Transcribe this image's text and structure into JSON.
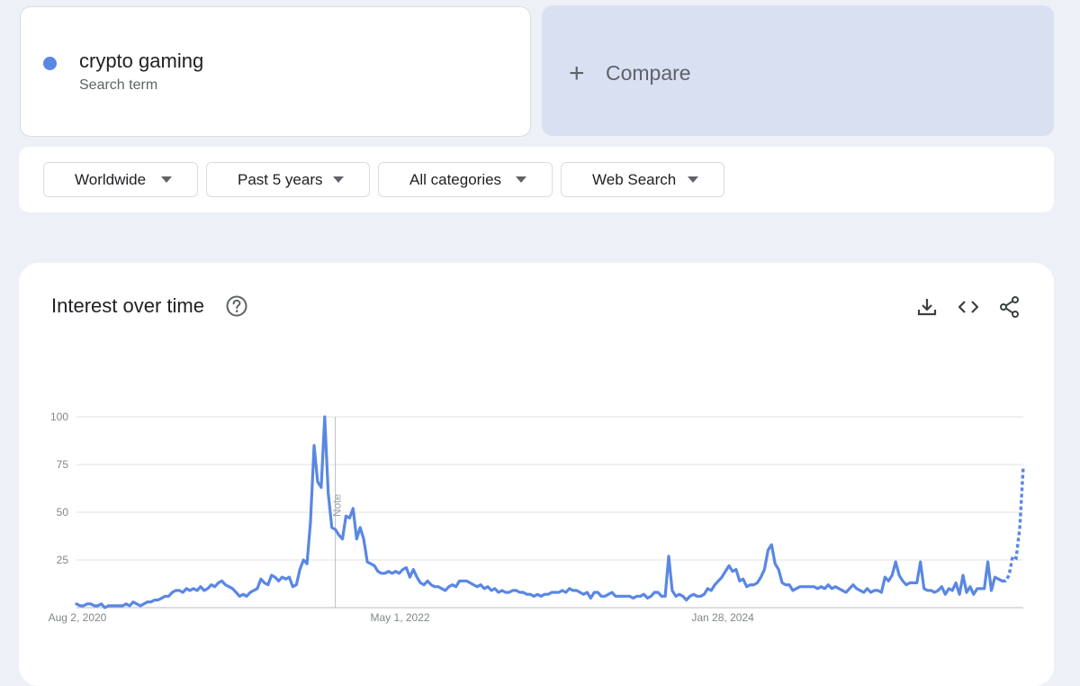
{
  "search_term": {
    "name": "crypto gaming",
    "subtitle": "Search term",
    "color": "#5a87e3"
  },
  "compare": {
    "label": "Compare",
    "background": "#d9e0f2"
  },
  "filters": [
    {
      "label": "Worldwide"
    },
    {
      "label": "Past 5 years"
    },
    {
      "label": "All categories"
    },
    {
      "label": "Web Search"
    }
  ],
  "chart_panel": {
    "title": "Interest over time",
    "icons": [
      "help-icon",
      "download-icon",
      "embed-icon",
      "share-icon"
    ]
  },
  "chart_data": {
    "type": "line",
    "yticks": [
      "100",
      "75",
      "50",
      "25"
    ],
    "ylim": [
      0,
      100
    ],
    "xtick_labels": [
      "Aug 2, 2020",
      "May 1, 2022",
      "Jan 28, 2024"
    ],
    "xtick_index": [
      0,
      91,
      182
    ],
    "note_label": "Note",
    "note_index": 73,
    "grid": true,
    "series_color": "#5a87e3",
    "partial_from_index": 261,
    "series": [
      {
        "values": [
          2,
          1,
          1,
          2,
          2,
          1,
          1,
          2,
          0,
          1,
          1,
          1,
          1,
          1,
          2,
          1,
          3,
          2,
          1,
          2,
          3,
          3,
          4,
          4,
          5,
          6,
          6,
          8,
          9,
          9,
          8,
          10,
          9,
          10,
          9,
          11,
          9,
          10,
          12,
          11,
          13,
          14,
          12,
          11,
          10,
          8,
          6,
          7,
          6,
          8,
          9,
          10,
          15,
          13,
          12,
          17,
          16,
          14,
          16,
          15,
          16,
          11,
          12,
          20,
          25,
          23,
          45,
          85,
          66,
          63,
          100,
          60,
          42,
          41,
          38,
          36,
          48,
          47,
          52,
          36,
          42,
          36,
          24,
          23,
          22,
          19,
          18,
          18,
          19,
          18,
          19,
          18,
          20,
          21,
          16,
          20,
          16,
          13,
          12,
          14,
          12,
          11,
          11,
          10,
          9,
          11,
          12,
          11,
          14,
          14,
          14,
          13,
          12,
          11,
          12,
          10,
          11,
          9,
          10,
          8,
          9,
          8,
          8,
          9,
          9,
          8,
          8,
          7,
          7,
          6,
          7,
          6,
          7,
          7,
          8,
          8,
          8,
          9,
          8,
          10,
          9,
          9,
          8,
          7,
          8,
          5,
          8,
          8,
          6,
          6,
          7,
          8,
          6,
          6,
          6,
          6,
          6,
          5,
          6,
          6,
          7,
          5,
          6,
          8,
          8,
          6,
          6,
          27,
          9,
          6,
          7,
          6,
          4,
          6,
          7,
          6,
          6,
          7,
          10,
          9,
          12,
          14,
          16,
          19,
          22,
          19,
          20,
          14,
          15,
          11,
          12,
          12,
          13,
          16,
          20,
          30,
          33,
          23,
          20,
          13,
          12,
          12,
          9,
          10,
          11,
          11,
          11,
          11,
          11,
          10,
          11,
          10,
          12,
          10,
          11,
          10,
          9,
          8,
          10,
          12,
          10,
          9,
          8,
          10,
          8,
          9,
          9,
          8,
          16,
          14,
          17,
          24,
          17,
          14,
          12,
          13,
          13,
          13,
          24,
          10,
          9,
          9,
          8,
          9,
          11,
          7,
          10,
          9,
          13,
          7,
          17,
          8,
          11,
          7,
          10,
          10,
          10,
          24,
          9,
          16,
          15,
          14,
          14,
          17,
          27,
          26,
          42,
          74
        ]
      }
    ]
  }
}
